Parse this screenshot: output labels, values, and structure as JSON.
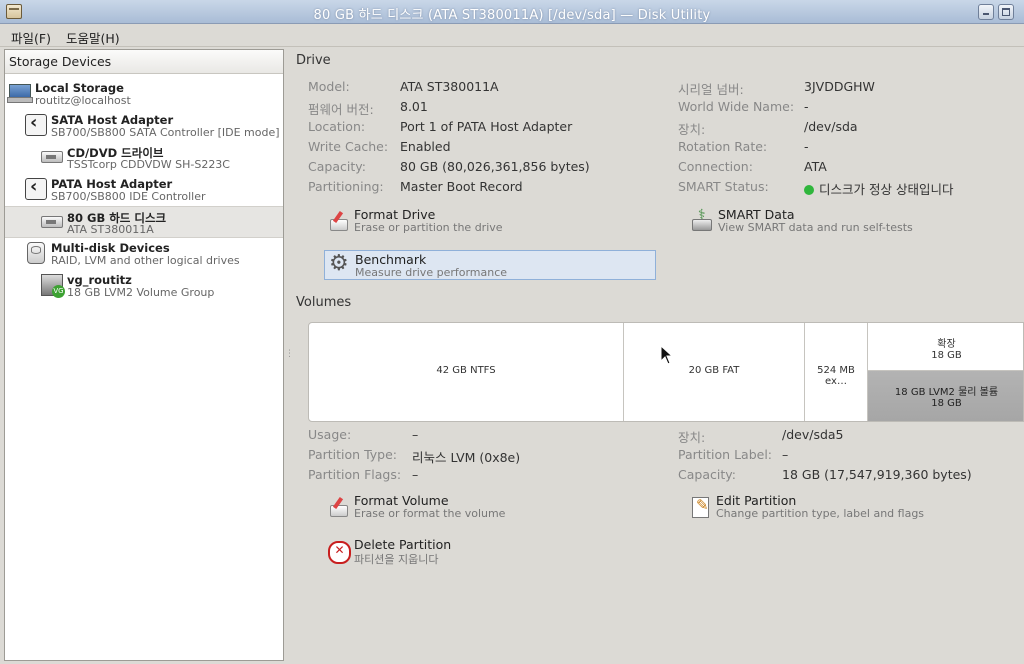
{
  "window": {
    "title": "80 GB 하드 디스크 (ATA ST380011A) [/dev/sda] — Disk Utility"
  },
  "menu": {
    "file": "파일(F)",
    "help": "도움말(H)"
  },
  "sidebar": {
    "header": "Storage Devices",
    "items": [
      {
        "title": "Local Storage",
        "subtitle": "routitz@localhost",
        "icon": "computer-icon"
      },
      {
        "title": "SATA Host Adapter",
        "subtitle": "SB700/SB800 SATA Controller [IDE mode]",
        "icon": "adapter-icon"
      },
      {
        "title": "CD/DVD 드라이브",
        "subtitle": "TSSTcorp CDDVDW SH-S223C",
        "icon": "optical-drive-icon"
      },
      {
        "title": "PATA Host Adapter",
        "subtitle": "SB700/SB800 IDE Controller",
        "icon": "adapter-icon"
      },
      {
        "title": "80 GB 하드 디스크",
        "subtitle": "ATA ST380011A",
        "icon": "hard-disk-icon"
      },
      {
        "title": "Multi-disk Devices",
        "subtitle": "RAID, LVM and other logical drives",
        "icon": "multidisk-icon"
      },
      {
        "title": "vg_routitz",
        "subtitle": "18 GB LVM2 Volume Group",
        "icon": "volume-group-icon"
      }
    ]
  },
  "drive": {
    "title": "Drive",
    "left": [
      {
        "label": "Model:",
        "value": "ATA ST380011A"
      },
      {
        "label": "펌웨어 버전:",
        "value": "8.01"
      },
      {
        "label": "Location:",
        "value": "Port 1 of PATA Host Adapter"
      },
      {
        "label": "Write Cache:",
        "value": "Enabled"
      },
      {
        "label": "Capacity:",
        "value": "80 GB (80,026,361,856 bytes)"
      },
      {
        "label": "Partitioning:",
        "value": "Master Boot Record"
      }
    ],
    "right": [
      {
        "label": "시리얼 넘버:",
        "value": "3JVDDGHW"
      },
      {
        "label": "World Wide Name:",
        "value": "-"
      },
      {
        "label": "장치:",
        "value": "/dev/sda"
      },
      {
        "label": "Rotation Rate:",
        "value": "-"
      },
      {
        "label": "Connection:",
        "value": "ATA"
      },
      {
        "label": "SMART Status:",
        "value": "디스크가 정상 상태입니다"
      }
    ],
    "actions": {
      "format": {
        "title": "Format Drive",
        "desc": "Erase or partition the drive"
      },
      "smart": {
        "title": "SMART Data",
        "desc": "View SMART data and run self-tests"
      },
      "benchmark": {
        "title": "Benchmark",
        "desc": "Measure drive performance"
      }
    }
  },
  "volumes": {
    "title": "Volumes",
    "map": {
      "ntfs": "42 GB NTFS",
      "fat": "20 GB FAT",
      "small": "524 MB ex…",
      "extended_top": "확장",
      "extended_size": "18 GB",
      "selected_name": "18 GB LVM2 물리 볼륨",
      "selected_size": "18 GB"
    },
    "left": [
      {
        "label": "Usage:",
        "value": "–"
      },
      {
        "label": "Partition Type:",
        "value": "리눅스 LVM (0x8e)"
      },
      {
        "label": "Partition Flags:",
        "value": "–"
      }
    ],
    "right": [
      {
        "label": "장치:",
        "value": "/dev/sda5"
      },
      {
        "label": "Partition Label:",
        "value": "–"
      },
      {
        "label": "Capacity:",
        "value": "18 GB (17,547,919,360 bytes)"
      }
    ],
    "actions": {
      "format": {
        "title": "Format Volume",
        "desc": "Erase or format the volume"
      },
      "edit": {
        "title": "Edit Partition",
        "desc": "Change partition type, label and flags"
      },
      "delete": {
        "title": "Delete Partition",
        "desc": "파티션을 지웁니다"
      }
    }
  }
}
